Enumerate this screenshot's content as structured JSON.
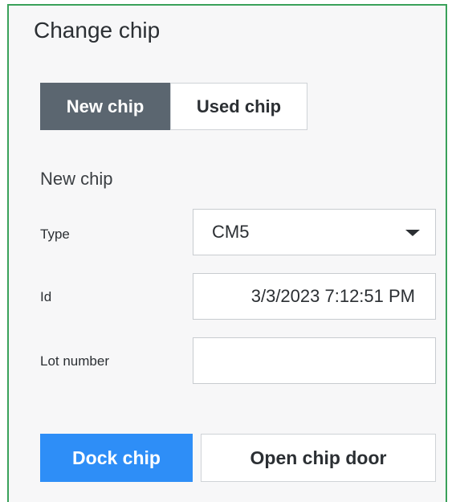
{
  "panel": {
    "title": "Change chip"
  },
  "chip_mode": {
    "options": [
      "New chip",
      "Used chip"
    ],
    "selected": "New chip"
  },
  "form": {
    "section_label": "New chip",
    "type": {
      "label": "Type",
      "value": "CM5",
      "options": [
        "CM5"
      ]
    },
    "id": {
      "label": "Id",
      "value": "3/3/2023 7:12:51 PM"
    },
    "lot_number": {
      "label": "Lot number",
      "value": ""
    }
  },
  "actions": {
    "dock": "Dock chip",
    "open_door": "Open chip door"
  },
  "colors": {
    "panel_border": "#3aa15a",
    "segment_selected_bg": "#5b6670",
    "primary_button_bg": "#2e8ef7",
    "panel_bg": "#f7f7f8"
  },
  "icons": {
    "type_dropdown": "chevron-down-icon"
  }
}
